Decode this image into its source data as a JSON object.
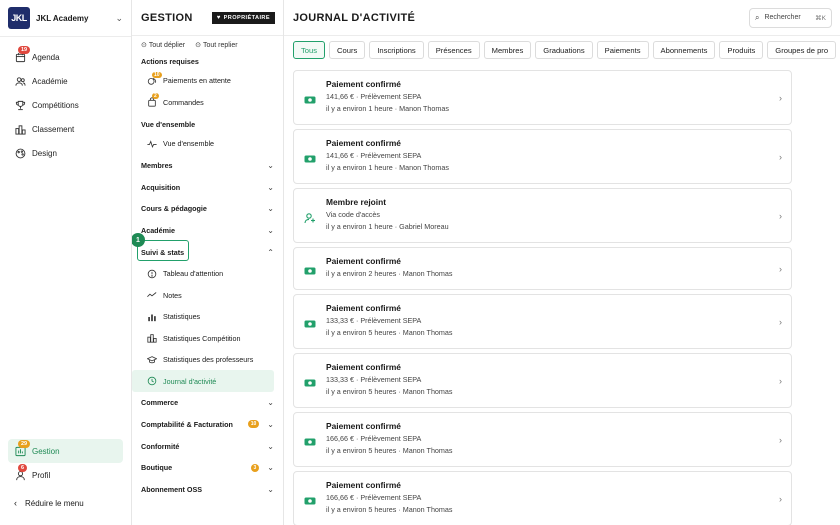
{
  "rail": {
    "brand_initials": "JKL",
    "brand_name": "JKL Academy",
    "items": [
      {
        "label": "Agenda",
        "icon": "calendar-icon",
        "badge": "19"
      },
      {
        "label": "Académie",
        "icon": "users-icon"
      },
      {
        "label": "Compétitions",
        "icon": "trophy-icon"
      },
      {
        "label": "Classement",
        "icon": "ranking-icon"
      },
      {
        "label": "Design",
        "icon": "palette-icon"
      }
    ],
    "bottom": [
      {
        "label": "Gestion",
        "icon": "chart-icon",
        "badge": "29"
      },
      {
        "label": "Profil",
        "icon": "user-icon",
        "badge": "6"
      }
    ],
    "reduce_label": "Réduire le menu"
  },
  "panel": {
    "title": "GESTION",
    "owner_badge": "PROPRIÉTAIRE",
    "expand_all": "Tout déplier",
    "collapse_all": "Tout replier",
    "actions_title": "Actions requises",
    "actions": [
      {
        "label": "Paiements en attente",
        "badge": "10"
      },
      {
        "label": "Commandes",
        "badge": "2"
      }
    ],
    "overview_title": "Vue d'ensemble",
    "overview_item": "Vue d'ensemble",
    "groups_top": [
      "Membres",
      "Acquisition",
      "Cours & pédagogie",
      "Académie"
    ],
    "focus_number": "1",
    "suivi_label": "Suivi & stats",
    "suivi_items": [
      "Tableau d'attention",
      "Notes",
      "Statistiques",
      "Statistiques Compétition",
      "Statistiques des professeurs",
      "Journal d'activité"
    ],
    "groups_bottom": [
      {
        "label": "Commerce"
      },
      {
        "label": "Comptabilité & Facturation",
        "badge": "10"
      },
      {
        "label": "Conformité"
      },
      {
        "label": "Boutique",
        "badge": "3"
      },
      {
        "label": "Abonnement OSS"
      }
    ]
  },
  "main": {
    "title": "JOURNAL D'ACTIVITÉ",
    "search_label": "Rechercher",
    "search_kbd": "⌘K",
    "tabs": [
      "Tous",
      "Cours",
      "Inscriptions",
      "Présences",
      "Membres",
      "Graduations",
      "Paiements",
      "Abonnements",
      "Produits",
      "Groupes de pro"
    ],
    "cards": [
      {
        "title": "Paiement confirmé",
        "line1": "141,66 € · Prélèvement SEPA",
        "line2": "il y a environ 1 heure · Manon Thomas",
        "icon": "money-icon"
      },
      {
        "title": "Paiement confirmé",
        "line1": "141,66 € · Prélèvement SEPA",
        "line2": "il y a environ 1 heure · Manon Thomas",
        "icon": "money-icon"
      },
      {
        "title": "Membre rejoint",
        "line1": "Via code d'accès",
        "line2": "il y a environ 1 heure · Gabriel Moreau",
        "icon": "user-plus-icon"
      },
      {
        "title": "Paiement confirmé",
        "line1": "",
        "line2": "il y a environ 2 heures · Manon Thomas",
        "icon": "money-icon"
      },
      {
        "title": "Paiement confirmé",
        "line1": "133,33 € · Prélèvement SEPA",
        "line2": "il y a environ 5 heures · Manon Thomas",
        "icon": "money-icon"
      },
      {
        "title": "Paiement confirmé",
        "line1": "133,33 € · Prélèvement SEPA",
        "line2": "il y a environ 5 heures · Manon Thomas",
        "icon": "money-icon"
      },
      {
        "title": "Paiement confirmé",
        "line1": "166,66 € · Prélèvement SEPA",
        "line2": "il y a environ 5 heures · Manon Thomas",
        "icon": "money-icon"
      },
      {
        "title": "Paiement confirmé",
        "line1": "166,66 € · Prélèvement SEPA",
        "line2": "il y a environ 5 heures · Manon Thomas",
        "icon": "money-icon"
      }
    ]
  },
  "colors": {
    "accent": "#22a06b",
    "badge_red": "#e0483e",
    "badge_amber": "#e8a01d",
    "brand": "#1f2d6b"
  }
}
